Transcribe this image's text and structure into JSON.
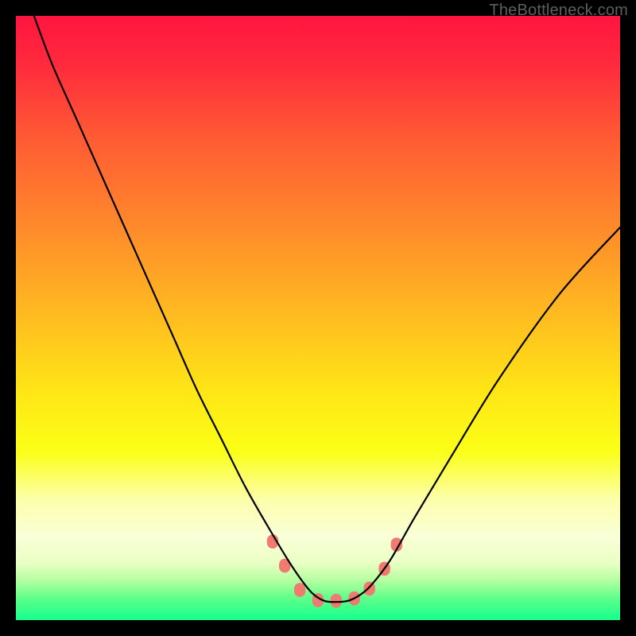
{
  "watermark": "TheBottleneck.com",
  "chart_data": {
    "type": "line",
    "title": "",
    "xlabel": "",
    "ylabel": "",
    "xlim": [
      0,
      100
    ],
    "ylim": [
      0,
      100
    ],
    "grid": false,
    "legend": false,
    "background": {
      "gradient_stops": [
        {
          "pos": 0.0,
          "color": "#ff153f"
        },
        {
          "pos": 0.08,
          "color": "#ff2a3d"
        },
        {
          "pos": 0.2,
          "color": "#ff5a34"
        },
        {
          "pos": 0.35,
          "color": "#ff8a2b"
        },
        {
          "pos": 0.5,
          "color": "#ffbd20"
        },
        {
          "pos": 0.62,
          "color": "#ffe516"
        },
        {
          "pos": 0.72,
          "color": "#fbff16"
        },
        {
          "pos": 0.8,
          "color": "#fcffa9"
        },
        {
          "pos": 0.86,
          "color": "#faffd7"
        },
        {
          "pos": 0.905,
          "color": "#eaffc4"
        },
        {
          "pos": 0.935,
          "color": "#b3ff9f"
        },
        {
          "pos": 0.965,
          "color": "#5bff8a"
        },
        {
          "pos": 1.0,
          "color": "#16ff8c"
        }
      ]
    },
    "series": [
      {
        "name": "bottleneck-curve",
        "color": "#000000",
        "width": 2.2,
        "x": [
          3,
          6,
          10,
          14,
          18,
          22,
          26,
          30,
          34,
          38,
          42,
          45,
          47,
          49,
          51,
          53,
          55,
          57,
          59,
          62,
          66,
          72,
          80,
          90,
          100
        ],
        "y": [
          100,
          92,
          83,
          74,
          65,
          56,
          47,
          38,
          30,
          22,
          15,
          10,
          7,
          4.5,
          3.2,
          3.0,
          3.2,
          4.2,
          6.0,
          10,
          17,
          27,
          40,
          54,
          65
        ]
      }
    ],
    "markers": {
      "name": "highlight-points",
      "color": "#ef7a6f",
      "radius": 8,
      "points": [
        {
          "x": 42.5,
          "y": 13
        },
        {
          "x": 44.5,
          "y": 9
        },
        {
          "x": 47.0,
          "y": 5
        },
        {
          "x": 50.0,
          "y": 3.3
        },
        {
          "x": 53.0,
          "y": 3.2
        },
        {
          "x": 56.0,
          "y": 3.6
        },
        {
          "x": 58.5,
          "y": 5.2
        },
        {
          "x": 61.0,
          "y": 8.5
        },
        {
          "x": 63.0,
          "y": 12.5
        }
      ]
    }
  }
}
